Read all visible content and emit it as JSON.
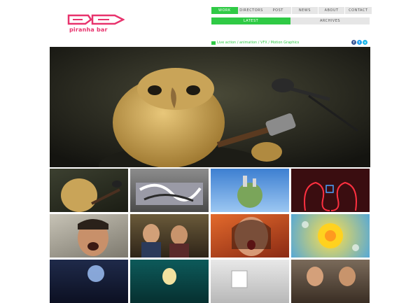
{
  "logo": {
    "text": "piranha bar"
  },
  "nav": {
    "items": [
      {
        "label": "Work",
        "active": true
      },
      {
        "label": "Directors",
        "active": false
      },
      {
        "label": "Post",
        "active": false
      },
      {
        "label": "News",
        "active": false
      },
      {
        "label": "About",
        "active": false
      },
      {
        "label": "Contact",
        "active": false
      }
    ]
  },
  "subnav": {
    "items": [
      {
        "label": "Latest",
        "active": true
      },
      {
        "label": "Archives",
        "active": false
      }
    ]
  },
  "breadcrumb": {
    "text": "Live action / animation / VFX / Motion Graphics"
  },
  "social": {
    "icons": [
      "facebook-icon",
      "twitter-icon",
      "vimeo-icon"
    ]
  },
  "colors": {
    "accent": "#2fca45",
    "brand": "#e8336d",
    "nav_bg": "#e6e6e6"
  }
}
